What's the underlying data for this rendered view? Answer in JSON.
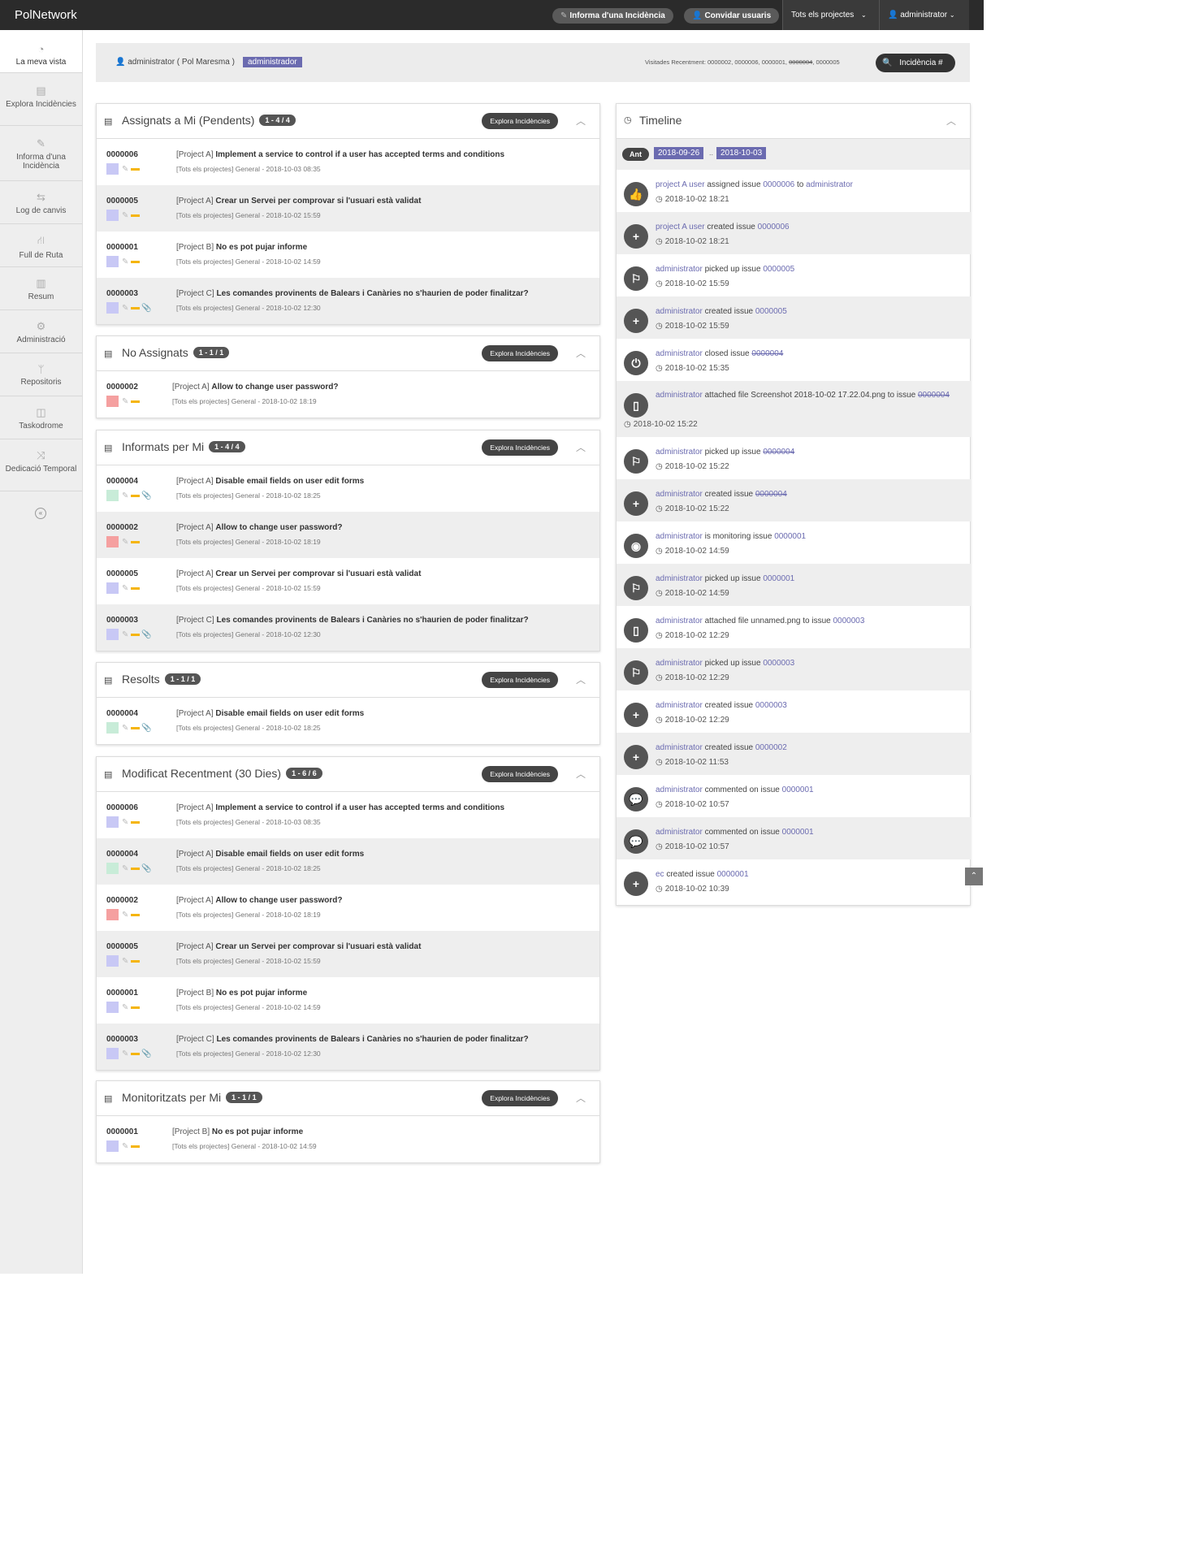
{
  "topbar": {
    "brand": "PolNetwork",
    "report_label": "Informa d'una Incidència",
    "invite_label": "Convidar usuaris",
    "project_label": "Tots els projectes",
    "user_label": "administrator"
  },
  "sidebar": {
    "items": [
      {
        "label": "La meva vista",
        "icon": "dashboard-icon"
      },
      {
        "label": "Explora Incidències",
        "icon": "list-icon"
      },
      {
        "label": "Informa d'una Incidència",
        "icon": "edit-icon"
      },
      {
        "label": "Log de canvis",
        "icon": "retweet-icon"
      },
      {
        "label": "Full de Ruta",
        "icon": "road-icon"
      },
      {
        "label": "Resum",
        "icon": "bar-chart-icon"
      },
      {
        "label": "Administració",
        "icon": "gears-icon"
      },
      {
        "label": "Repositoris",
        "icon": "code-fork-icon"
      },
      {
        "label": "Taskodrome",
        "icon": "columns-icon"
      },
      {
        "label": "Dedicació Temporal",
        "icon": "random-icon"
      }
    ]
  },
  "userbar": {
    "user": "administrator ( Pol Maresma )",
    "role": "administrador",
    "recent_prefix": "Visitades Recentment: ",
    "recent_1": "0000002, 0000006, 0000001, ",
    "recent_2": "0000004",
    "recent_3": ", 0000005",
    "search_label": "Incidència #"
  },
  "explore_label": "Explora Incidències",
  "colors": {
    "purple": "#c8c8f5",
    "red": "#f5a0a0",
    "green": "#c8ecd8",
    "accent": "#6b6bb0"
  },
  "panels": [
    {
      "title": "Assignats a Mi (Pendents)",
      "badge": "1 - 4 / 4",
      "rows": [
        {
          "id": "0000006",
          "project": "[Project A] ",
          "summary": "Implement a service to control if a user has accepted terms and conditions",
          "meta": "[Tots els projectes] General - 2018-10-03 08:35",
          "color": "purple",
          "attach": false
        },
        {
          "id": "0000005",
          "project": "[Project A] ",
          "summary": "Crear un Servei per comprovar si l'usuari està validat",
          "meta": "[Tots els projectes] General - 2018-10-02 15:59",
          "color": "purple",
          "attach": false
        },
        {
          "id": "0000001",
          "project": "[Project B] ",
          "summary": "No es pot pujar informe",
          "meta": "[Tots els projectes] General - 2018-10-02 14:59",
          "color": "purple",
          "attach": false
        },
        {
          "id": "0000003",
          "project": "[Project C] ",
          "summary": "Les comandes provinents de Balears i Canàries no s'haurien de poder finalitzar?",
          "meta": "[Tots els projectes] General - 2018-10-02 12:30",
          "color": "purple",
          "attach": true
        }
      ]
    },
    {
      "title": "No Assignats",
      "badge": "1 - 1 / 1",
      "rows": [
        {
          "id": "0000002",
          "project": "[Project A] ",
          "summary": "Allow to change user password?",
          "meta": "[Tots els projectes] General - 2018-10-02 18:19",
          "color": "red",
          "attach": false
        }
      ]
    },
    {
      "title": "Informats per Mi",
      "badge": "1 - 4 / 4",
      "rows": [
        {
          "id": "0000004",
          "project": "[Project A] ",
          "summary": "Disable email fields on user edit forms",
          "meta": "[Tots els projectes] General - 2018-10-02 18:25",
          "color": "green",
          "attach": true
        },
        {
          "id": "0000002",
          "project": "[Project A] ",
          "summary": "Allow to change user password?",
          "meta": "[Tots els projectes] General - 2018-10-02 18:19",
          "color": "red",
          "attach": false
        },
        {
          "id": "0000005",
          "project": "[Project A] ",
          "summary": "Crear un Servei per comprovar si l'usuari està validat",
          "meta": "[Tots els projectes] General - 2018-10-02 15:59",
          "color": "purple",
          "attach": false
        },
        {
          "id": "0000003",
          "project": "[Project C] ",
          "summary": "Les comandes provinents de Balears i Canàries no s'haurien de poder finalitzar?",
          "meta": "[Tots els projectes] General - 2018-10-02 12:30",
          "color": "purple",
          "attach": true
        }
      ]
    },
    {
      "title": "Resolts",
      "badge": "1 - 1 / 1",
      "rows": [
        {
          "id": "0000004",
          "project": "[Project A] ",
          "summary": "Disable email fields on user edit forms",
          "meta": "[Tots els projectes] General - 2018-10-02 18:25",
          "color": "green",
          "attach": true
        }
      ]
    },
    {
      "title": "Modificat Recentment (30 Dies)",
      "badge": "1 - 6 / 6",
      "rows": [
        {
          "id": "0000006",
          "project": "[Project A] ",
          "summary": "Implement a service to control if a user has accepted terms and conditions",
          "meta": "[Tots els projectes] General - 2018-10-03 08:35",
          "color": "purple",
          "attach": false
        },
        {
          "id": "0000004",
          "project": "[Project A] ",
          "summary": "Disable email fields on user edit forms",
          "meta": "[Tots els projectes] General - 2018-10-02 18:25",
          "color": "green",
          "attach": true
        },
        {
          "id": "0000002",
          "project": "[Project A] ",
          "summary": "Allow to change user password?",
          "meta": "[Tots els projectes] General - 2018-10-02 18:19",
          "color": "red",
          "attach": false
        },
        {
          "id": "0000005",
          "project": "[Project A] ",
          "summary": "Crear un Servei per comprovar si l'usuari està validat",
          "meta": "[Tots els projectes] General - 2018-10-02 15:59",
          "color": "purple",
          "attach": false
        },
        {
          "id": "0000001",
          "project": "[Project B] ",
          "summary": "No es pot pujar informe",
          "meta": "[Tots els projectes] General - 2018-10-02 14:59",
          "color": "purple",
          "attach": false
        },
        {
          "id": "0000003",
          "project": "[Project C] ",
          "summary": "Les comandes provinents de Balears i Canàries no s'haurien de poder finalitzar?",
          "meta": "[Tots els projectes] General - 2018-10-02 12:30",
          "color": "purple",
          "attach": true
        }
      ]
    },
    {
      "title": "Monitoritzats per Mi",
      "badge": "1 - 1 / 1",
      "rows": [
        {
          "id": "0000001",
          "project": "[Project B] ",
          "summary": "No es pot pujar informe",
          "meta": "[Tots els projectes] General - 2018-10-02 14:59",
          "color": "purple",
          "attach": false
        }
      ]
    }
  ],
  "timeline": {
    "title": "Timeline",
    "prev_label": "Ant",
    "date_from": "2018-09-26",
    "date_sep": "..",
    "date_to": "2018-10-03",
    "events": [
      {
        "icon": "thumbs-up-icon",
        "glyph": "👍",
        "actor": "project A user",
        "action": " assigned issue ",
        "issue": "0000006",
        "struck": false,
        "suffix": " to ",
        "target": "administrator",
        "time": "2018-10-02 18:21"
      },
      {
        "icon": "plus-icon",
        "glyph": "+",
        "actor": "project A user",
        "action": " created issue ",
        "issue": "0000006",
        "struck": false,
        "suffix": "",
        "target": "",
        "time": "2018-10-02 18:21"
      },
      {
        "icon": "flag-icon",
        "glyph": "⚐",
        "actor": "administrator",
        "action": " picked up issue ",
        "issue": "0000005",
        "struck": false,
        "suffix": "",
        "target": "",
        "time": "2018-10-02 15:59"
      },
      {
        "icon": "plus-icon",
        "glyph": "+",
        "actor": "administrator",
        "action": " created issue ",
        "issue": "0000005",
        "struck": false,
        "suffix": "",
        "target": "",
        "time": "2018-10-02 15:59"
      },
      {
        "icon": "power-icon",
        "glyph": "⏻",
        "actor": "administrator",
        "action": " closed issue ",
        "issue": "0000004",
        "struck": true,
        "suffix": "",
        "target": "",
        "time": "2018-10-02 15:35"
      },
      {
        "icon": "file-icon",
        "glyph": "▯",
        "actor": "administrator",
        "action": " attached file Screenshot 2018-10-02 17.22.04.png to issue ",
        "issue": "0000004",
        "struck": true,
        "suffix": "",
        "target": "",
        "time": "2018-10-02 15:22",
        "wrap": true
      },
      {
        "icon": "flag-icon",
        "glyph": "⚐",
        "actor": "administrator",
        "action": " picked up issue ",
        "issue": "0000004",
        "struck": true,
        "suffix": "",
        "target": "",
        "time": "2018-10-02 15:22"
      },
      {
        "icon": "plus-icon",
        "glyph": "+",
        "actor": "administrator",
        "action": " created issue ",
        "issue": "0000004",
        "struck": true,
        "suffix": "",
        "target": "",
        "time": "2018-10-02 15:22"
      },
      {
        "icon": "eye-icon",
        "glyph": "◉",
        "actor": "administrator",
        "action": " is monitoring issue ",
        "issue": "0000001",
        "struck": false,
        "suffix": "",
        "target": "",
        "time": "2018-10-02 14:59"
      },
      {
        "icon": "flag-icon",
        "glyph": "⚐",
        "actor": "administrator",
        "action": " picked up issue ",
        "issue": "0000001",
        "struck": false,
        "suffix": "",
        "target": "",
        "time": "2018-10-02 14:59"
      },
      {
        "icon": "file-icon",
        "glyph": "▯",
        "actor": "administrator",
        "action": " attached file unnamed.png to issue ",
        "issue": "0000003",
        "struck": false,
        "suffix": "",
        "target": "",
        "time": "2018-10-02 12:29"
      },
      {
        "icon": "flag-icon",
        "glyph": "⚐",
        "actor": "administrator",
        "action": " picked up issue ",
        "issue": "0000003",
        "struck": false,
        "suffix": "",
        "target": "",
        "time": "2018-10-02 12:29"
      },
      {
        "icon": "plus-icon",
        "glyph": "+",
        "actor": "administrator",
        "action": " created issue ",
        "issue": "0000003",
        "struck": false,
        "suffix": "",
        "target": "",
        "time": "2018-10-02 12:29"
      },
      {
        "icon": "plus-icon",
        "glyph": "+",
        "actor": "administrator",
        "action": " created issue ",
        "issue": "0000002",
        "struck": false,
        "suffix": "",
        "target": "",
        "time": "2018-10-02 11:53"
      },
      {
        "icon": "comment-icon",
        "glyph": "💬",
        "actor": "administrator",
        "action": " commented on issue ",
        "issue": "0000001",
        "struck": false,
        "suffix": "",
        "target": "",
        "time": "2018-10-02 10:57"
      },
      {
        "icon": "comment-icon",
        "glyph": "💬",
        "actor": "administrator",
        "action": " commented on issue ",
        "issue": "0000001",
        "struck": false,
        "suffix": "",
        "target": "",
        "time": "2018-10-02 10:57"
      },
      {
        "icon": "plus-icon",
        "glyph": "+",
        "actor": "ec",
        "action": " created issue ",
        "issue": "0000001",
        "struck": false,
        "suffix": "",
        "target": "",
        "time": "2018-10-02 10:39"
      }
    ]
  }
}
